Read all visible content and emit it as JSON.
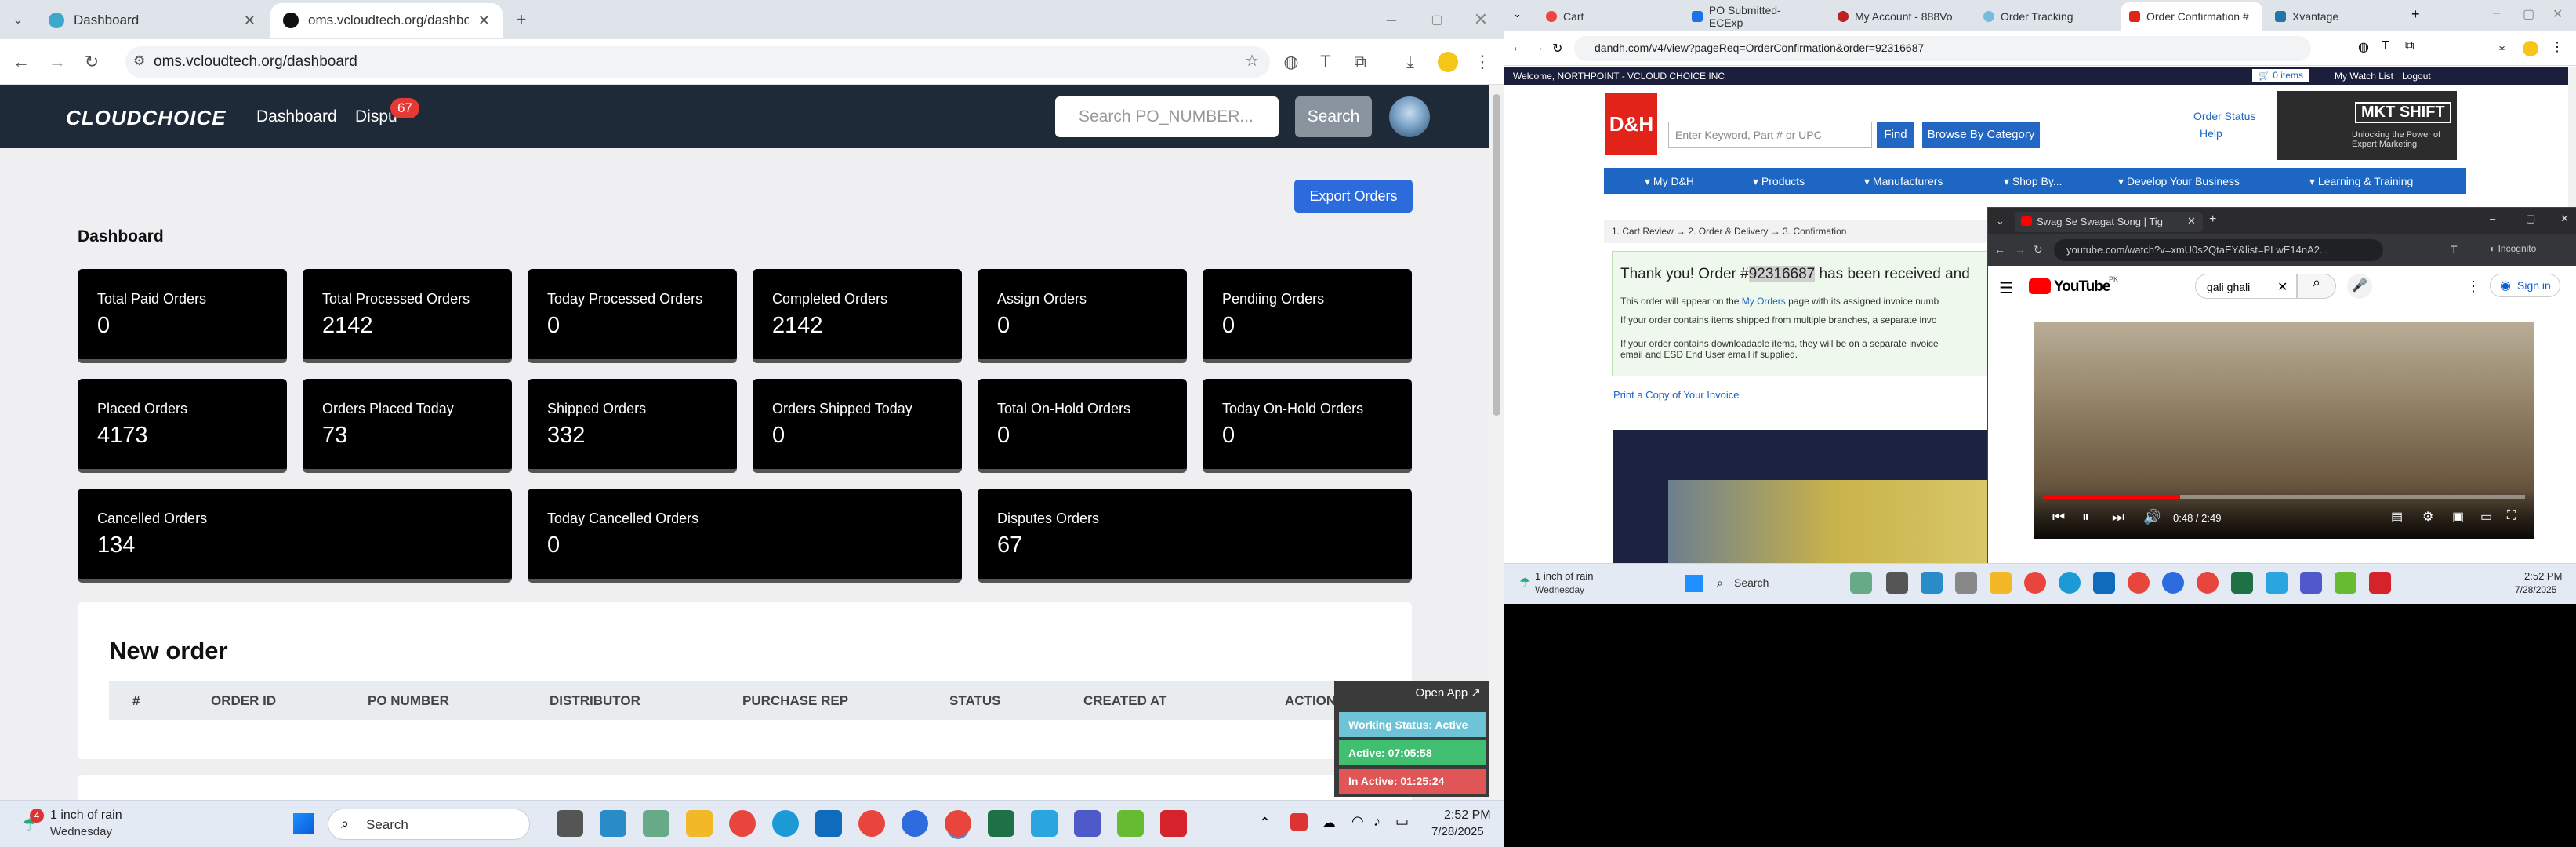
{
  "left_browser": {
    "tabs": [
      {
        "title": "Dashboard",
        "active": false
      },
      {
        "title": "oms.vcloudtech.org/dashboard",
        "active": true
      }
    ],
    "url": "oms.vcloudtech.org/dashboard"
  },
  "app": {
    "logo": "CLOUDCHOICE",
    "nav": {
      "dashboard": "Dashboard",
      "disputes": "Dispu",
      "disputes_badge": "67"
    },
    "search_placeholder": "Search PO_NUMBER...",
    "search_button": "Search",
    "export_button": "Export Orders",
    "dashboard_title": "Dashboard",
    "cards": [
      {
        "label": "Total Paid Orders",
        "value": "0"
      },
      {
        "label": "Total Processed Orders",
        "value": "2142"
      },
      {
        "label": "Today Processed Orders",
        "value": "0"
      },
      {
        "label": "Completed Orders",
        "value": "2142"
      },
      {
        "label": "Assign Orders",
        "value": "0"
      },
      {
        "label": "Pendiing Orders",
        "value": "0"
      },
      {
        "label": "Placed Orders",
        "value": "4173"
      },
      {
        "label": "Orders Placed Today",
        "value": "73"
      },
      {
        "label": "Shipped Orders",
        "value": "332"
      },
      {
        "label": "Orders Shipped Today",
        "value": "0"
      },
      {
        "label": "Total On-Hold Orders",
        "value": "0"
      },
      {
        "label": "Today On-Hold Orders",
        "value": "0"
      },
      {
        "label": "Cancelled Orders",
        "value": "134"
      },
      {
        "label": "Today Cancelled Orders",
        "value": "0"
      },
      {
        "label": "Disputes Orders",
        "value": "67"
      }
    ],
    "new_order": {
      "title": "New order",
      "columns": [
        "#",
        "ORDER ID",
        "PO NUMBER",
        "DISTRIBUTOR",
        "PURCHASE REP",
        "STATUS",
        "CREATED AT",
        "ACTION"
      ]
    },
    "widget": {
      "open_app": "Open App ↗",
      "working_status": "Working Status: Active",
      "active": "Active: 07:05:58",
      "inactive": "In Active: 01:25:24"
    }
  },
  "left_taskbar": {
    "weather_temp": "1 inch of rain",
    "weather_day": "Wednesday",
    "weather_badge": "4",
    "search": "Search",
    "time": "2:52 PM",
    "date": "7/28/2025"
  },
  "right_browser": {
    "tabs": [
      "Cart",
      "PO Submitted- ECExp",
      "My Account - 888Vo",
      "Order Tracking",
      "Order Confirmation #",
      "Xvantage"
    ],
    "url": "dandh.com/v4/view?pageReq=OrderConfirmation&order=92316687",
    "welcome": "Welcome, NORTHPOINT - VCLOUD CHOICE INC",
    "cart_items": "0 items",
    "watch_list": "My Watch List",
    "logout": "Logout",
    "logo": "D&H",
    "search_placeholder": "Enter Keyword, Part # or UPC",
    "find": "Find",
    "browse": "Browse By Category",
    "order_status": "Order Status",
    "help": "Help",
    "ad_title": "MKT SHIFT",
    "ad_sub": "Unlocking the Power of Expert Marketing",
    "nav": [
      "▾ My D&H",
      "▾ Products",
      "▾ Manufacturers",
      "▾ Shop By...",
      "▾ Develop Your Business",
      "▾ Learning & Training"
    ],
    "breadcrumb": "1. Cart Review → 2. Order & Delivery → 3. Confirmation",
    "thanks_prefix": "Thank you! Order #",
    "order_number": "92316687",
    "thanks_suffix": " has been received and",
    "line1a": "This order will appear on the ",
    "line1_link": "My Orders",
    "line1b": " page with its assigned invoice numb",
    "line2": "If your order contains items shipped from multiple branches, a separate invo",
    "line3a": "If your order contains downloadable items, they will be on a separate invoice",
    "line3b": "email and ESD End User email if supplied.",
    "print_link": "Print a Copy of Your Invoice"
  },
  "youtube": {
    "tab": "Swag Se Swagat Song | Tig",
    "url": "youtube.com/watch?v=xmU0s2QtaEY&list=PLwE14nA2...",
    "incognito": "Incognito",
    "logo": "YouTube",
    "region": "PK",
    "query": "gali ghali",
    "sign_in": "Sign in",
    "time": "0:48 / 2:49",
    "progress": 0.284
  },
  "right_taskbar": {
    "weather_temp": "1 inch of rain",
    "weather_day": "Wednesday",
    "search": "Search",
    "time": "2:52 PM",
    "date": "7/28/2025"
  }
}
